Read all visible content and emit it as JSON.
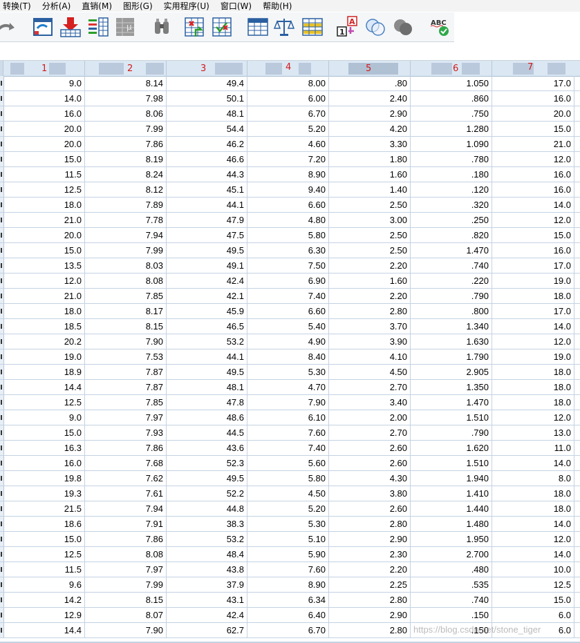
{
  "menu": [
    "转换(T)",
    "分析(A)",
    "直销(M)",
    "图形(G)",
    "实用程序(U)",
    "窗口(W)",
    "帮助(H)"
  ],
  "toolbar": [
    {
      "icon": "redo-icon"
    },
    {
      "icon": "recall-dialog-icon"
    },
    {
      "icon": "goto-case-icon"
    },
    {
      "icon": "goto-variable-icon"
    },
    {
      "icon": "variables-icon"
    },
    {
      "icon": "find-icon"
    },
    {
      "icon": "insert-cases-icon"
    },
    {
      "icon": "insert-variable-icon"
    },
    {
      "icon": "split-file-icon"
    },
    {
      "icon": "weight-cases-icon"
    },
    {
      "icon": "select-cases-icon"
    },
    {
      "icon": "value-labels-icon"
    },
    {
      "icon": "use-variable-sets-icon"
    },
    {
      "icon": "show-all-variables-icon"
    },
    {
      "icon": "spell-check-icon"
    }
  ],
  "columns": [
    "1",
    "2",
    "3",
    "4",
    "5",
    "6",
    "7"
  ],
  "rows": [
    [
      "9.0",
      "8.14",
      "49.4",
      "8.00",
      ".80",
      "1.050",
      "17.0"
    ],
    [
      "14.0",
      "7.98",
      "50.1",
      "6.00",
      "2.40",
      ".860",
      "16.0"
    ],
    [
      "16.0",
      "8.06",
      "48.1",
      "6.70",
      "2.90",
      ".750",
      "20.0"
    ],
    [
      "20.0",
      "7.99",
      "54.4",
      "5.20",
      "4.20",
      "1.280",
      "15.0"
    ],
    [
      "20.0",
      "7.86",
      "46.2",
      "4.60",
      "3.30",
      "1.090",
      "21.0"
    ],
    [
      "15.0",
      "8.19",
      "46.6",
      "7.20",
      "1.80",
      ".780",
      "12.0"
    ],
    [
      "11.5",
      "8.24",
      "44.3",
      "8.90",
      "1.60",
      ".180",
      "16.0"
    ],
    [
      "12.5",
      "8.12",
      "45.1",
      "9.40",
      "1.40",
      ".120",
      "16.0"
    ],
    [
      "18.0",
      "7.89",
      "44.1",
      "6.60",
      "2.50",
      ".320",
      "14.0"
    ],
    [
      "21.0",
      "7.78",
      "47.9",
      "4.80",
      "3.00",
      ".250",
      "12.0"
    ],
    [
      "20.0",
      "7.94",
      "47.5",
      "5.80",
      "2.50",
      ".820",
      "15.0"
    ],
    [
      "15.0",
      "7.99",
      "49.5",
      "6.30",
      "2.50",
      "1.470",
      "16.0"
    ],
    [
      "13.5",
      "8.03",
      "49.1",
      "7.50",
      "2.20",
      ".740",
      "17.0"
    ],
    [
      "12.0",
      "8.08",
      "42.4",
      "6.90",
      "1.60",
      ".220",
      "19.0"
    ],
    [
      "21.0",
      "7.85",
      "42.1",
      "7.40",
      "2.20",
      ".790",
      "18.0"
    ],
    [
      "18.0",
      "8.17",
      "45.9",
      "6.60",
      "2.80",
      ".800",
      "17.0"
    ],
    [
      "18.5",
      "8.15",
      "46.5",
      "5.40",
      "3.70",
      "1.340",
      "14.0"
    ],
    [
      "20.2",
      "7.90",
      "53.2",
      "4.90",
      "3.90",
      "1.630",
      "12.0"
    ],
    [
      "19.0",
      "7.53",
      "44.1",
      "8.40",
      "4.10",
      "1.790",
      "19.0"
    ],
    [
      "18.9",
      "7.87",
      "49.5",
      "5.30",
      "4.50",
      "2.905",
      "18.0"
    ],
    [
      "14.4",
      "7.87",
      "48.1",
      "4.70",
      "2.70",
      "1.350",
      "18.0"
    ],
    [
      "12.5",
      "7.85",
      "47.8",
      "7.90",
      "3.40",
      "1.470",
      "18.0"
    ],
    [
      "9.0",
      "7.97",
      "48.6",
      "6.10",
      "2.00",
      "1.510",
      "12.0"
    ],
    [
      "15.0",
      "7.93",
      "44.5",
      "7.60",
      "2.70",
      ".790",
      "13.0"
    ],
    [
      "16.3",
      "7.86",
      "43.6",
      "7.40",
      "2.60",
      "1.620",
      "11.0"
    ],
    [
      "16.0",
      "7.68",
      "52.3",
      "5.60",
      "2.60",
      "1.510",
      "14.0"
    ],
    [
      "19.8",
      "7.62",
      "49.5",
      "5.80",
      "4.30",
      "1.940",
      "8.0"
    ],
    [
      "19.3",
      "7.61",
      "52.2",
      "4.50",
      "3.80",
      "1.410",
      "18.0"
    ],
    [
      "21.5",
      "7.94",
      "44.8",
      "5.20",
      "2.60",
      "1.440",
      "18.0"
    ],
    [
      "18.6",
      "7.91",
      "38.3",
      "5.30",
      "2.80",
      "1.480",
      "14.0"
    ],
    [
      "15.0",
      "7.86",
      "53.2",
      "5.10",
      "2.90",
      "1.950",
      "12.0"
    ],
    [
      "12.5",
      "8.08",
      "48.4",
      "5.90",
      "2.30",
      "2.700",
      "14.0"
    ],
    [
      "11.5",
      "7.97",
      "43.8",
      "7.60",
      "2.20",
      ".480",
      "10.0"
    ],
    [
      "9.6",
      "7.99",
      "37.9",
      "8.90",
      "2.25",
      ".535",
      "12.5"
    ],
    [
      "14.2",
      "8.15",
      "43.1",
      "6.34",
      "2.80",
      ".740",
      "15.0"
    ],
    [
      "12.9",
      "8.07",
      "42.4",
      "6.40",
      "2.90",
      ".150",
      "6.0"
    ],
    [
      "14.4",
      "7.90",
      "62.7",
      "6.70",
      "2.80",
      ".150",
      "6.0"
    ]
  ],
  "watermark": "https://blog.csdn.net/stone_tiger"
}
